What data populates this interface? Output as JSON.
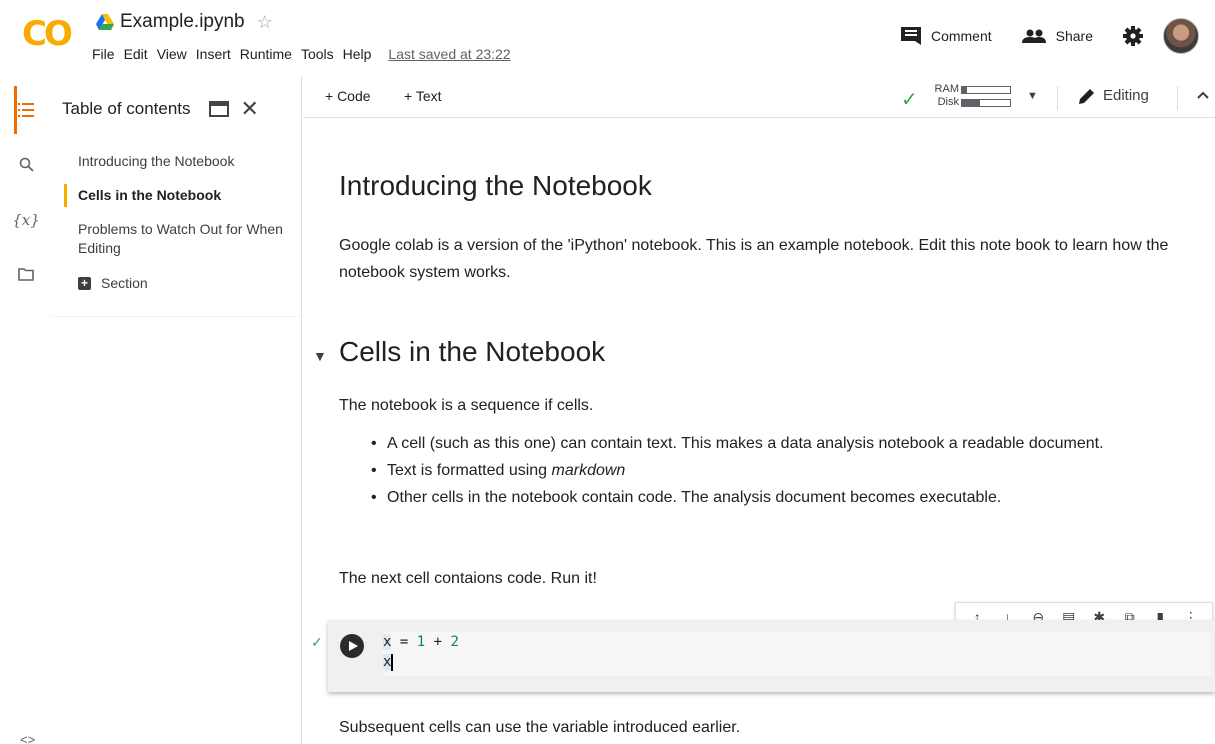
{
  "app": {
    "logo_text": "CO",
    "notebook_title": "Example.ipynb",
    "menu": [
      "File",
      "Edit",
      "View",
      "Insert",
      "Runtime",
      "Tools",
      "Help"
    ],
    "last_saved": "Last saved at 23:22",
    "comment_label": "Comment",
    "share_label": "Share"
  },
  "sidebar": {
    "rail_icons": [
      "toc-icon",
      "search-icon",
      "variables-icon",
      "folder-icon"
    ],
    "variables_glyph": "{x}",
    "bottom_glyph": "<>",
    "toc_title": "Table of contents",
    "toc_items": [
      {
        "label": "Introducing the Notebook"
      },
      {
        "label": "Cells in the Notebook"
      },
      {
        "label": "Problems to Watch Out for When Editing"
      }
    ],
    "section_label": "Section"
  },
  "toolbar": {
    "add_code": "+ Code",
    "add_text": "+ Text",
    "ram_label": "RAM",
    "disk_label": "Disk",
    "ram_usage": 0.1,
    "disk_usage": 0.38,
    "editing_label": "Editing"
  },
  "notebook": {
    "h1": "Introducing the Notebook",
    "intro": "Google colab is a version of the 'iPython' notebook. This is an example notebook. Edit this note book to learn how the notebook system works.",
    "h2": "Cells in the Notebook",
    "p_sequence": "The notebook is a sequence if cells.",
    "bullets": [
      {
        "text": "A cell (such as this one) can contain text. This makes a data analysis notebook a readable document."
      },
      {
        "pre": "Text is formatted using ",
        "em": "markdown"
      },
      {
        "text": "Other cells in the notebook contain code. The analysis document becomes executable."
      }
    ],
    "p_next": "The next cell contaions code. Run it!",
    "code": {
      "line1_var": "x",
      "line1_op1": " = ",
      "line1_n1": "1",
      "line1_op2": " + ",
      "line1_n2": "2",
      "line2": "x"
    },
    "p_after": "Subsequent cells can use the variable introduced earlier."
  },
  "colors": {
    "logo": "#f9ab00",
    "active_rail": "#ef6c00",
    "active_toc": "#f9ab00",
    "success": "#34a853",
    "number": "#098658"
  }
}
